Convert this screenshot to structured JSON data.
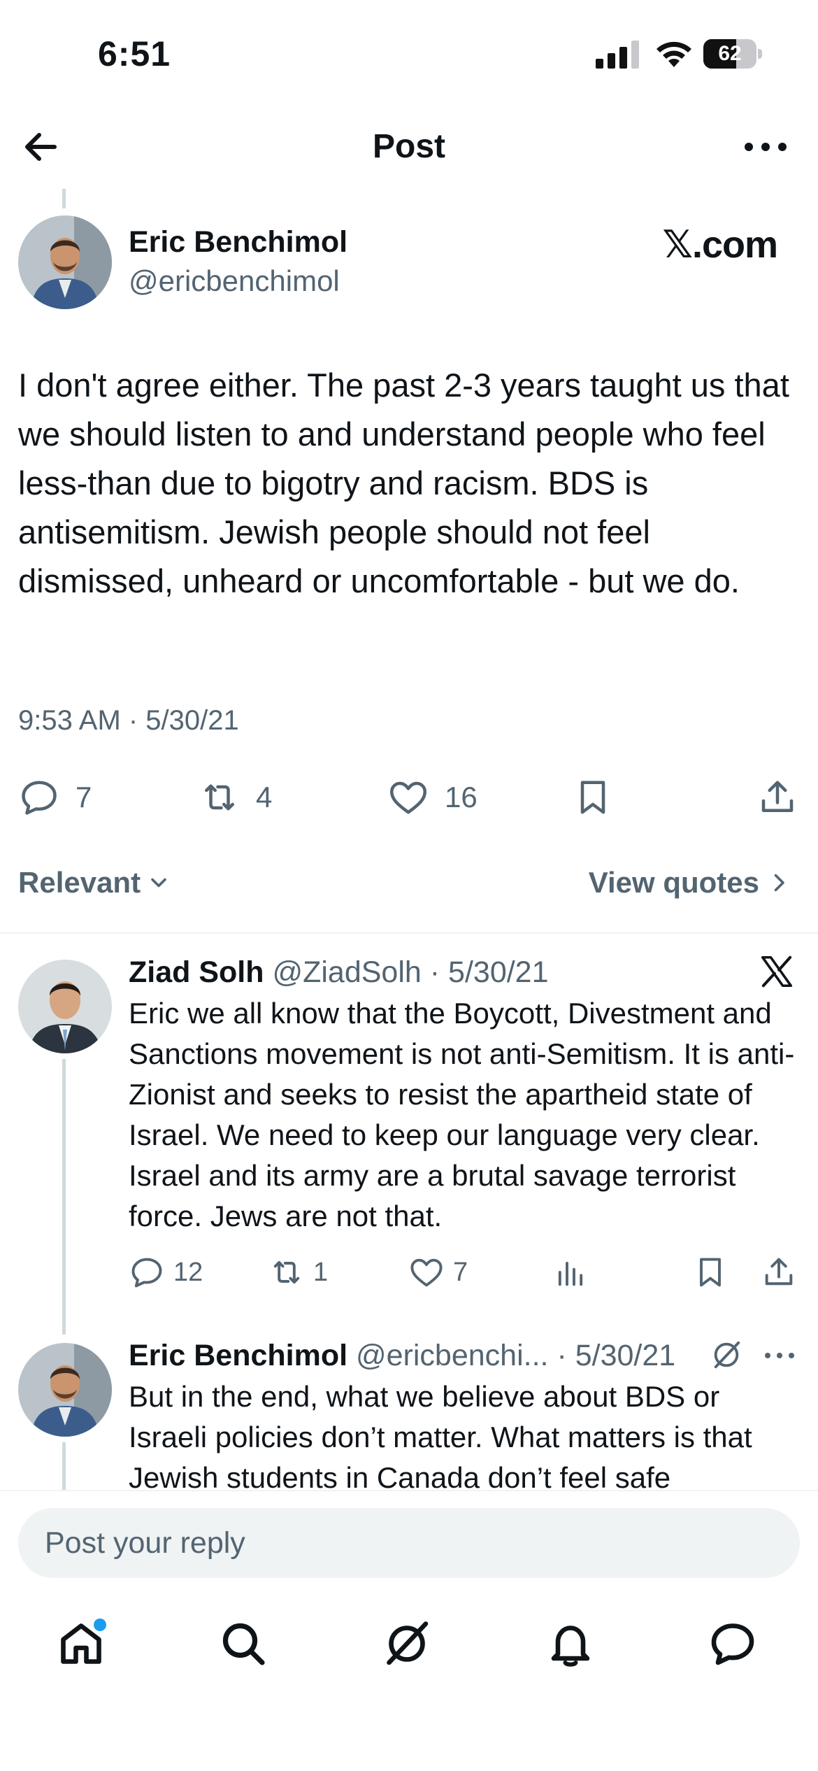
{
  "status_bar": {
    "time": "6:51",
    "battery_level": "62",
    "battery_fraction": 0.62
  },
  "header": {
    "title": "Post"
  },
  "main_post": {
    "author_name": "Eric Benchimol",
    "author_handle": "@ericbenchimol",
    "source_label": "𝕏.com",
    "text": "I don't agree either. The past 2-3 years taught us that we should listen to and understand people who feel less-than due to bigotry and racism. BDS is antisemitism. Jewish people should not feel dismissed, unheard or uncomfortable - but we do.",
    "timestamp": "9:53 AM · 5/30/21",
    "replies": "7",
    "reposts": "4",
    "likes": "16"
  },
  "sort": {
    "label": "Relevant",
    "view_quotes": "View quotes"
  },
  "replies": [
    {
      "author_name": "Ziad Solh",
      "author_handle": "@ZiadSolh",
      "date": "· 5/30/21",
      "text": "Eric we all know that the Boycott, Divestment and Sanctions movement is not anti-Semitism. It is anti-Zionist and seeks to resist the apartheid state of Israel. We need to keep our language very clear. Israel and its army are a brutal savage terrorist force. Jews are not that.",
      "replies": "12",
      "reposts": "1",
      "likes": "7"
    },
    {
      "author_name": "Eric Benchimol",
      "author_handle": "@ericbenchi...",
      "date": "· 5/30/21",
      "text": "But in the end, what we believe about BDS or Israeli policies don’t matter. What matters is that Jewish students in Canada don’t feel safe"
    }
  ],
  "reply_box": {
    "placeholder": "Post your reply"
  },
  "colors": {
    "accent": "#1d9bf0",
    "secondary_text": "#536471",
    "divider": "#eff3f4"
  },
  "icons": {
    "header": [
      "back-arrow-icon",
      "more-icon"
    ],
    "actions": [
      "reply-icon",
      "repost-icon",
      "like-icon",
      "bookmark-icon",
      "share-icon",
      "views-icon"
    ],
    "tabs": [
      "home-icon",
      "search-icon",
      "grok-icon",
      "notifications-icon",
      "messages-icon"
    ]
  }
}
